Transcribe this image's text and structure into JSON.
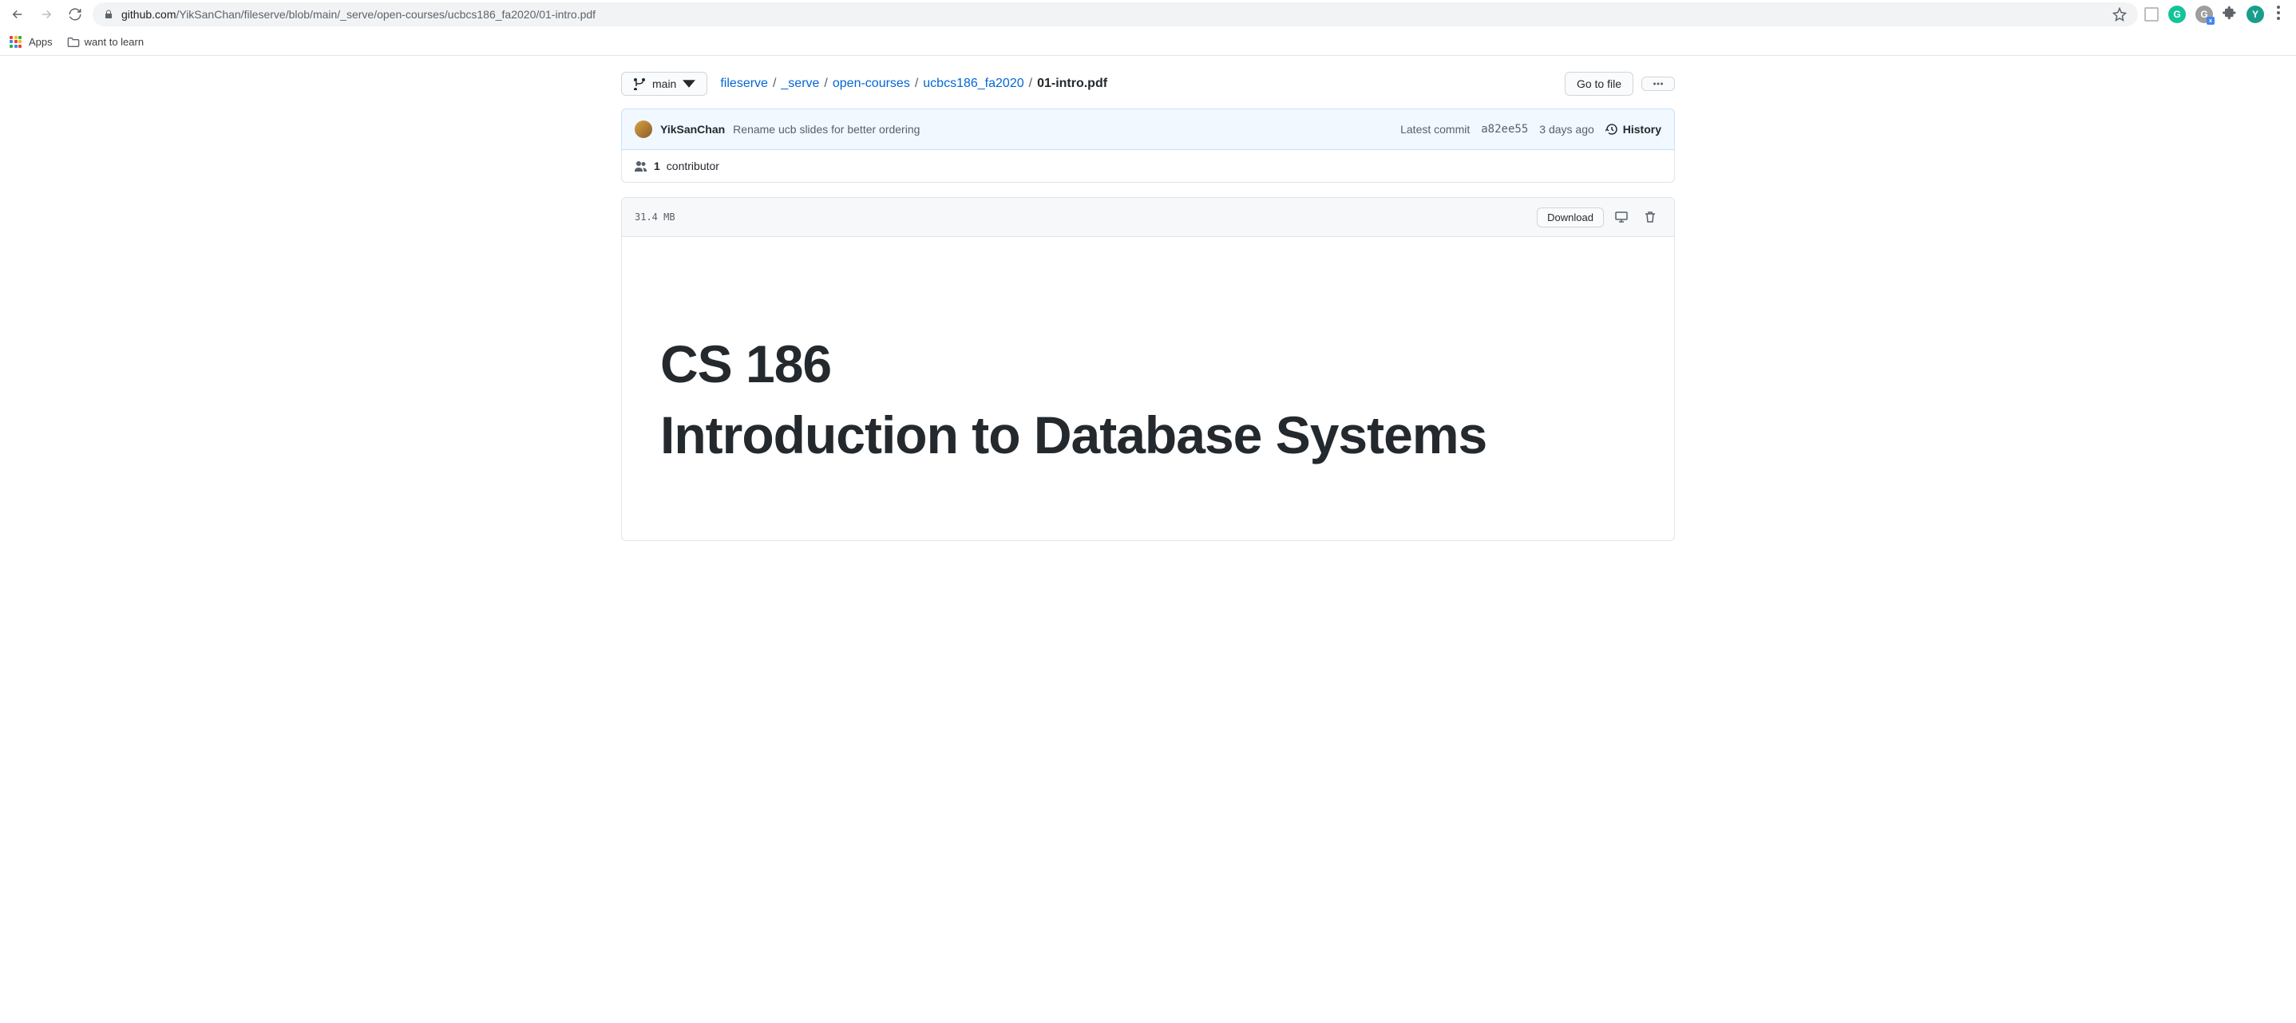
{
  "browser": {
    "url_domain": "github.com",
    "url_path": "/YikSanChan/fileserve/blob/main/_serve/open-courses/ucbcs186_fa2020/01-intro.pdf",
    "apps_label": "Apps",
    "bookmark_1": "want to learn",
    "profile_initial": "Y"
  },
  "branch": {
    "label": "main"
  },
  "breadcrumbs": {
    "root": "fileserve",
    "p1": "_serve",
    "p2": "open-courses",
    "p3": "ucbcs186_fa2020",
    "final": "01-intro.pdf",
    "sep": "/"
  },
  "nav_right": {
    "go_to_file": "Go to file"
  },
  "commit": {
    "author": "YikSanChan",
    "message": "Rename ucb slides for better ordering",
    "latest_label": "Latest commit",
    "sha": "a82ee55",
    "time": "3 days ago",
    "history": "History"
  },
  "contrib": {
    "count": "1",
    "label": "contributor"
  },
  "file": {
    "size": "31.4 MB",
    "download": "Download"
  },
  "pdf": {
    "line1": "CS 186",
    "line2": "Introduction to Database Systems"
  }
}
